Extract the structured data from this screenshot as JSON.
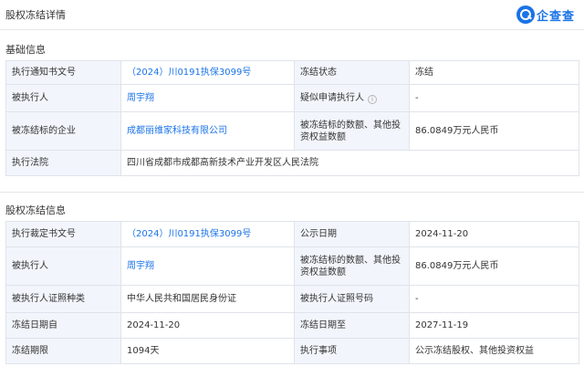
{
  "header": {
    "title": "股权冻结详情",
    "logo_text": "企查查"
  },
  "basic": {
    "title": "基础信息",
    "notice_no_label": "执行通知书文号",
    "notice_no": "（2024）川0191执保3099号",
    "status_label": "冻结状态",
    "status": "冻结",
    "executee_label": "被执行人",
    "executee": "周宇翔",
    "suspected_label": "疑似申请执行人",
    "suspected": "-",
    "company_label": "被冻结标的企业",
    "company": "成都丽维家科技有限公司",
    "amount_label": "被冻结标的数额、其他投资权益数额",
    "amount": "86.0849万元人民币",
    "court_label": "执行法院",
    "court": "四川省成都市成都高新技术产业开发区人民法院"
  },
  "freeze": {
    "title": "股权冻结信息",
    "ruling_no_label": "执行裁定书文号",
    "ruling_no": "（2024）川0191执保3099号",
    "publish_date_label": "公示日期",
    "publish_date": "2024-11-20",
    "executee_label": "被执行人",
    "executee": "周宇翔",
    "amount_label": "被冻结标的数额、其他投资权益数额",
    "amount": "86.0849万元人民币",
    "id_type_label": "被执行人证照种类",
    "id_type": "中华人民共和国居民身份证",
    "id_no_label": "被执行人证照号码",
    "id_no": "-",
    "start_label": "冻结日期自",
    "start": "2024-11-20",
    "end_label": "冻结日期至",
    "end": "2027-11-19",
    "period_label": "冻结期限",
    "period": "1094天",
    "matter_label": "执行事项",
    "matter": "公示冻结股权、其他投资权益"
  }
}
